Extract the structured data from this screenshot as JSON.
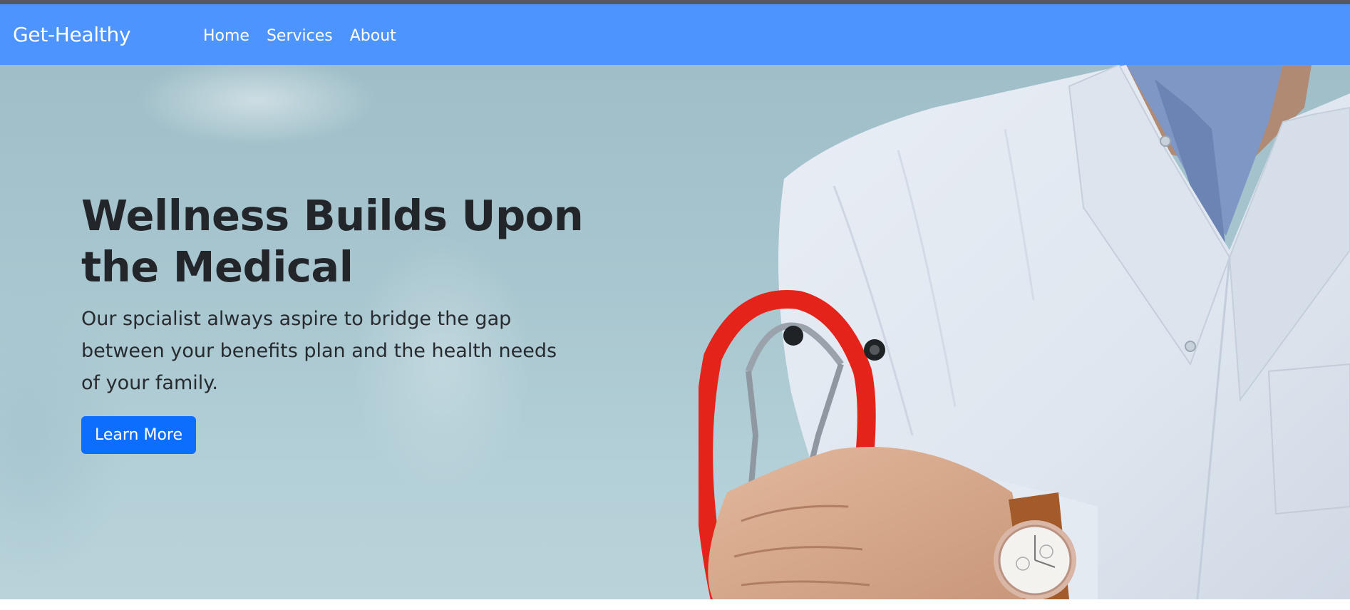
{
  "navbar": {
    "brand": "Get-Healthy",
    "links": [
      "Home",
      "Services",
      "About"
    ],
    "background_color": "#4d94ff"
  },
  "hero": {
    "title": "Wellness Builds Upon the Medical",
    "text": "Our spcialist always aspire to bridge the gap between your benefits plan and the health needs of your family.",
    "button_label": "Learn More",
    "button_color": "#0d6efd",
    "image": "doctor-with-stethoscope-photo"
  }
}
